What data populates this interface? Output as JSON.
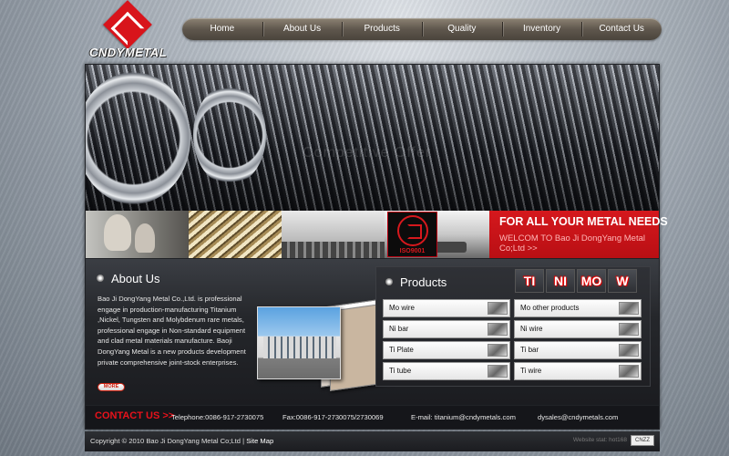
{
  "logo": {
    "wordmark": "CNDYMETAL"
  },
  "nav": {
    "items": [
      {
        "label": "Home"
      },
      {
        "label": "About Us"
      },
      {
        "label": "Products"
      },
      {
        "label": "Quality"
      },
      {
        "label": "Inventory"
      },
      {
        "label": "Contact Us"
      }
    ]
  },
  "hero": {
    "caption": "Competitive Offer"
  },
  "banner": {
    "stamp_text": "ISO9001",
    "headline": "FOR ALL YOUR METAL NEEDS",
    "welcome": "WELCOM TO Bao Ji DongYang Metal Co;Ltd >>"
  },
  "about": {
    "title": "About Us",
    "text": "Bao Ji DongYang Metal Co.,Ltd. is professional engage in production-manufacturing Titanium ,Nickel, Tungsten and Molybdenum rare metals, professional engage in Non-standard equipment and clad metal materials manufacture. Baoji DongYang Metal is a new products development private comprehensive joint-stock enterprises.",
    "more_label": "MORE"
  },
  "products": {
    "title": "Products",
    "tabs": [
      "TI",
      "NI",
      "MO",
      "W"
    ],
    "items": [
      {
        "label": "Mo wire"
      },
      {
        "label": "Mo other products"
      },
      {
        "label": "Ni bar"
      },
      {
        "label": "Ni wire"
      },
      {
        "label": "Ti Plate"
      },
      {
        "label": "Ti bar"
      },
      {
        "label": "Ti tube"
      },
      {
        "label": "Ti wire"
      }
    ]
  },
  "contact": {
    "label": "CONTACT US >>",
    "telephone": "Telephone:0086-917-2730075",
    "fax": "Fax:0086-917-2730075/2730069",
    "email": "E-mail: titanium@cndymetals.com",
    "email2": "dysales@cndymetals.com"
  },
  "footer": {
    "copyright": "Copyright © 2010 Bao Ji DongYang Metal Co;Ltd |",
    "sitemap": "Site Map",
    "stats": "Website stat: hot168",
    "badge": "CNZZ"
  },
  "colors": {
    "accent_red": "#d8141b",
    "nav_bg": "#5f574d",
    "panel_dark": "#202226"
  }
}
